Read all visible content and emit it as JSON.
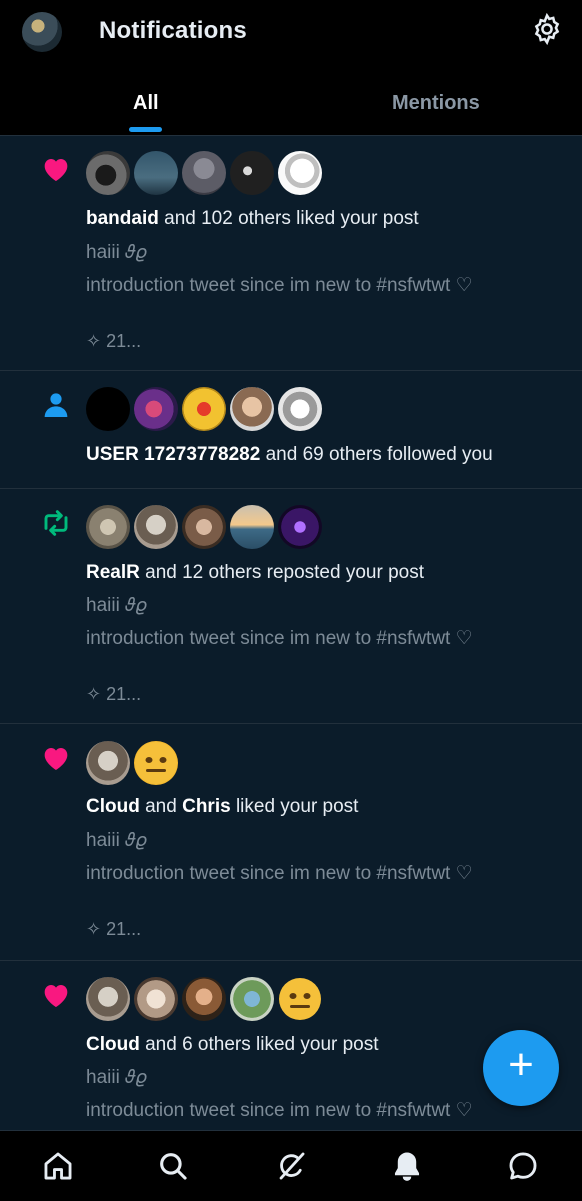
{
  "header": {
    "title": "Notifications"
  },
  "tabs": [
    {
      "label": "All",
      "active": true
    },
    {
      "label": "Mentions",
      "active": false
    }
  ],
  "notifications": [
    {
      "type": "like",
      "actor": "bandaid",
      "rest": " and 102 others liked your post",
      "post_line1": "haiii 𝜗𝜚",
      "post_line2": "introduction tweet since im new to #nsfwtwt ♡",
      "stat": "✧ 21..."
    },
    {
      "type": "follow",
      "actor": "USER 17273778282",
      "rest": " and 69 others followed you"
    },
    {
      "type": "repost",
      "actor": "RealR",
      "rest": " and 12 others reposted your post",
      "post_line1": "haiii 𝜗𝜚",
      "post_line2": "introduction tweet since im new to #nsfwtwt ♡",
      "stat": "✧ 21..."
    },
    {
      "type": "like",
      "actor": "Cloud",
      "mid": " and ",
      "actor2": "Chris",
      "rest": " liked your post",
      "post_line1": "haiii 𝜗𝜚",
      "post_line2": "introduction tweet since im new to #nsfwtwt ♡",
      "stat": "✧ 21..."
    },
    {
      "type": "like",
      "actor": "Cloud",
      "rest": " and 6 others liked your post",
      "post_line1": "haiii 𝜗𝜚",
      "post_line2": "introduction tweet since im new to #nsfwtwt ♡"
    }
  ],
  "fab": {
    "label": "+"
  },
  "bottom_nav": [
    "home-icon",
    "search-icon",
    "grok-icon",
    "notifications-icon",
    "messages-icon"
  ],
  "colors": {
    "accent": "#1d9bf0",
    "like": "#f91880",
    "repost": "#00ba7c",
    "background": "#0b1c2a"
  }
}
